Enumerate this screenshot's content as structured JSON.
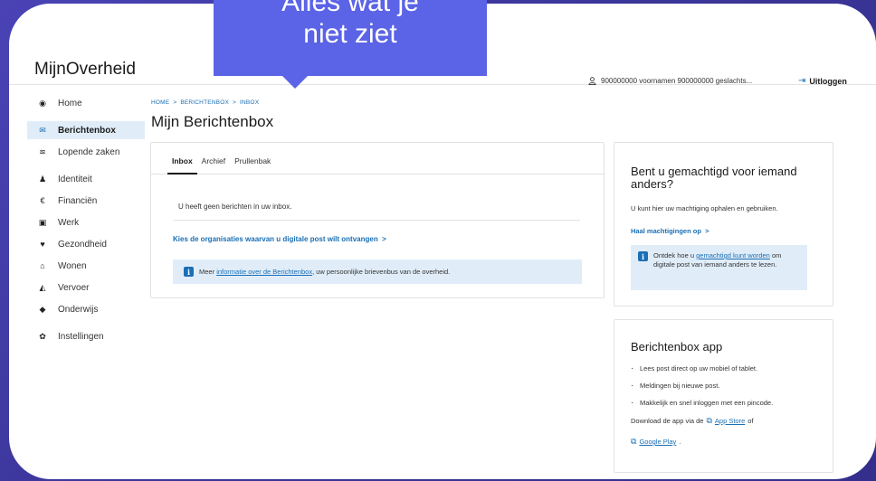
{
  "callout": {
    "line1": "Alles wat je",
    "line2": "niet ziet"
  },
  "header": {
    "logo": "MijnOverheid",
    "user": "900000000 voornamen 900000000 geslachts...",
    "logout": "Uitloggen"
  },
  "sidebar": {
    "items": [
      {
        "label": "Home",
        "icon": "home-icon"
      },
      {
        "label": "Berichtenbox",
        "icon": "mail-icon",
        "active": true
      },
      {
        "label": "Lopende zaken",
        "icon": "stack-icon"
      },
      {
        "label": "Identiteit",
        "icon": "person-icon"
      },
      {
        "label": "Financiën",
        "icon": "euro-icon"
      },
      {
        "label": "Werk",
        "icon": "briefcase-icon"
      },
      {
        "label": "Gezondheid",
        "icon": "heart-icon"
      },
      {
        "label": "Wonen",
        "icon": "house-icon"
      },
      {
        "label": "Vervoer",
        "icon": "car-icon"
      },
      {
        "label": "Onderwijs",
        "icon": "graduation-cap-icon"
      },
      {
        "label": "Instellingen",
        "icon": "gear-icon"
      }
    ]
  },
  "breadcrumb": [
    "HOME",
    "BERICHTENBOX",
    "INBOX"
  ],
  "breadcrumb_sep": ">",
  "page_title": "Mijn Berichtenbox",
  "inbox": {
    "tabs": [
      "Inbox",
      "Archief",
      "Prullenbak"
    ],
    "empty_message": "U heeft geen berichten in uw inbox.",
    "org_link": "Kies de organisaties waarvan u digitale post wilt ontvangen",
    "arrow": ">",
    "info_prefix": "Meer",
    "info_link": "informatie over de Berichtenbox",
    "info_suffix": ", uw persoonlijke brievenbus van de overheid."
  },
  "authorization": {
    "title": "Bent u gemachtigd voor iemand anders?",
    "text": "U kunt hier uw machtiging ophalen en gebruiken.",
    "link": "Haal machtigingen op",
    "arrow": ">",
    "info_prefix": "Ontdek hoe u",
    "info_link": "gemachtigd kunt worden",
    "info_suffix": "om digitale post van iemand anders te lezen."
  },
  "app": {
    "title": "Berichtenbox app",
    "bullets": [
      "Lees post direct op uw mobiel of tablet.",
      "Meldingen bij nieuwe post.",
      "Makkelijk en snel inloggen met een pincode."
    ],
    "download_prefix": "Download de app via de",
    "app_store": "App Store",
    "download_mid": "of",
    "google_play": "Google Play",
    "download_end": "."
  },
  "colors": {
    "accent": "#1a6fb5",
    "callout": "#5b63e6",
    "highlight": "#e0edf9",
    "background": "#3e3a9e"
  }
}
